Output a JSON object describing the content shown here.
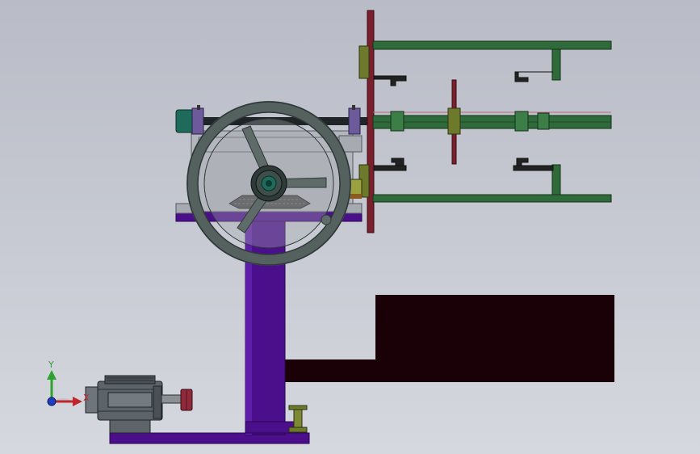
{
  "view": {
    "background_top": "#b9bcc6",
    "background_bottom": "#d6d8df"
  },
  "colors": {
    "purple": "#4b0f8c",
    "purple_dark": "#35086a",
    "maroon": "#7a1f2c",
    "green": "#2f6b3a",
    "green_dark": "#1f4a27",
    "olive": "#6d7a2b",
    "dark_block": "#1a0007",
    "wheel": "#55615f",
    "wheel_dark": "#2f3838",
    "steel": "#8a9094",
    "motor": "#5d6469",
    "pulley": "#8e2a3a",
    "teal": "#1e6b5b"
  },
  "triad": {
    "y_label": "Y",
    "x_label": "X",
    "y_color": "#2fa12f",
    "x_color": "#c0272d",
    "z_color": "#1f3fbf"
  }
}
